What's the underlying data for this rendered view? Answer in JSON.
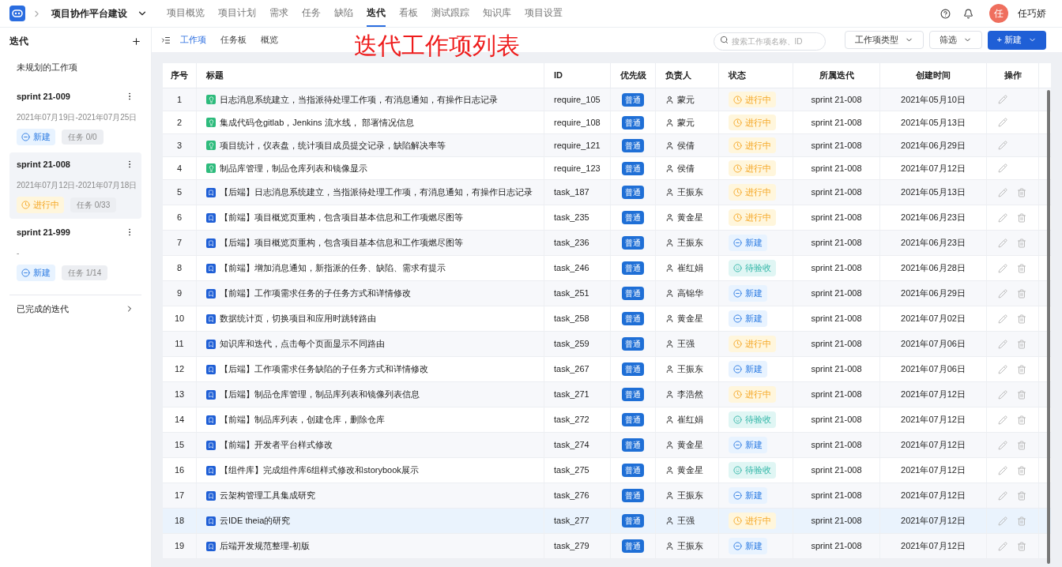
{
  "header": {
    "project": "项目协作平台建设",
    "nav": [
      {
        "label": "项目概览",
        "selected": false
      },
      {
        "label": "项目计划",
        "selected": false
      },
      {
        "label": "需求",
        "selected": false
      },
      {
        "label": "任务",
        "selected": false
      },
      {
        "label": "缺陷",
        "selected": false
      },
      {
        "label": "迭代",
        "selected": true
      },
      {
        "label": "看板",
        "selected": false
      },
      {
        "label": "测试跟踪",
        "selected": false
      },
      {
        "label": "知识库",
        "selected": false
      },
      {
        "label": "项目设置",
        "selected": false
      }
    ],
    "avatar": "任",
    "user": "任巧娇"
  },
  "sidebar": {
    "title": "迭代",
    "unplanned": "未规划的工作项",
    "sprints": [
      {
        "name": "sprint 21-009",
        "dates": "2021年07月19日-2021年07月25日",
        "status": {
          "kind": "new",
          "label": "新建"
        },
        "tasks": "任务 0/0",
        "selected": false
      },
      {
        "name": "sprint 21-008",
        "dates": "2021年07月12日-2021年07月18日",
        "status": {
          "kind": "in_progress",
          "label": "进行中"
        },
        "tasks": "任务 0/33",
        "selected": true
      },
      {
        "name": "sprint 21-999",
        "dates": "-",
        "status": {
          "kind": "new",
          "label": "新建"
        },
        "tasks": "任务 1/14",
        "selected": false
      }
    ],
    "completed": "已完成的迭代"
  },
  "subnav": {
    "tabs": [
      {
        "label": "工作项",
        "selected": true
      },
      {
        "label": "任务板",
        "selected": false
      },
      {
        "label": "概览",
        "selected": false
      }
    ],
    "search": {
      "placeholder": "搜索工作项名称、ID"
    },
    "filters": [
      "工作项类型",
      "筛选"
    ],
    "new_button": "+ 新建"
  },
  "annotation": "迭代工作项列表",
  "table": {
    "columns": [
      "序号",
      "标题",
      "ID",
      "优先级",
      "负责人",
      "状态",
      "所属迭代",
      "创建时间",
      "操作"
    ],
    "rows": [
      {
        "no": "1",
        "kind": "requirement",
        "title": "日志消息系统建立，当指派待处理工作项，有消息通知，有操作日志记录",
        "id": "require_105",
        "priority": "普通",
        "owner": "蒙元",
        "status": {
          "kind": "in_progress",
          "label": "进行中"
        },
        "sprint": "sprint 21-008",
        "created": "2021年05月10日",
        "deletable": false,
        "selected": false
      },
      {
        "no": "2",
        "kind": "requirement",
        "title": "集成代码仓gitlab，Jenkins 流水线， 部署情况信息",
        "id": "require_108",
        "priority": "普通",
        "owner": "蒙元",
        "status": {
          "kind": "in_progress",
          "label": "进行中"
        },
        "sprint": "sprint 21-008",
        "created": "2021年05月13日",
        "deletable": false,
        "selected": false
      },
      {
        "no": "3",
        "kind": "requirement",
        "title": "项目统计，仪表盘，统计项目成员提交记录，缺陷解决率等",
        "id": "require_121",
        "priority": "普通",
        "owner": "侯倩",
        "status": {
          "kind": "in_progress",
          "label": "进行中"
        },
        "sprint": "sprint 21-008",
        "created": "2021年06月29日",
        "deletable": false,
        "selected": false
      },
      {
        "no": "4",
        "kind": "requirement",
        "title": "制品库管理，制品仓库列表和镜像显示",
        "id": "require_123",
        "priority": "普通",
        "owner": "侯倩",
        "status": {
          "kind": "in_progress",
          "label": "进行中"
        },
        "sprint": "sprint 21-008",
        "created": "2021年07月12日",
        "deletable": false,
        "selected": false
      },
      {
        "no": "5",
        "kind": "task",
        "title": "【后端】日志消息系统建立，当指派待处理工作项，有消息通知，有操作日志记录",
        "id": "task_187",
        "priority": "普通",
        "owner": "王振东",
        "status": {
          "kind": "in_progress",
          "label": "进行中"
        },
        "sprint": "sprint 21-008",
        "created": "2021年05月13日",
        "deletable": true,
        "selected": false
      },
      {
        "no": "6",
        "kind": "task",
        "title": "【前端】项目概览页重构，包含项目基本信息和工作项燃尽图等",
        "id": "task_235",
        "priority": "普通",
        "owner": "黄金星",
        "status": {
          "kind": "in_progress",
          "label": "进行中"
        },
        "sprint": "sprint 21-008",
        "created": "2021年06月23日",
        "deletable": true,
        "selected": false
      },
      {
        "no": "7",
        "kind": "task",
        "title": "【后端】项目概览页重构，包含项目基本信息和工作项燃尽图等",
        "id": "task_236",
        "priority": "普通",
        "owner": "王振东",
        "status": {
          "kind": "new",
          "label": "新建"
        },
        "sprint": "sprint 21-008",
        "created": "2021年06月23日",
        "deletable": true,
        "selected": false
      },
      {
        "no": "8",
        "kind": "task",
        "title": "【前端】增加消息通知，新指派的任务、缺陷、需求有提示",
        "id": "task_246",
        "priority": "普通",
        "owner": "崔红娟",
        "status": {
          "kind": "review",
          "label": "待验收"
        },
        "sprint": "sprint 21-008",
        "created": "2021年06月28日",
        "deletable": true,
        "selected": false
      },
      {
        "no": "9",
        "kind": "task",
        "title": "【前端】工作项需求任务的子任务方式和详情修改",
        "id": "task_251",
        "priority": "普通",
        "owner": "高锦华",
        "status": {
          "kind": "new",
          "label": "新建"
        },
        "sprint": "sprint 21-008",
        "created": "2021年06月29日",
        "deletable": true,
        "selected": false
      },
      {
        "no": "10",
        "kind": "task",
        "title": "数据统计页，切换项目和应用时跳转路由",
        "id": "task_258",
        "priority": "普通",
        "owner": "黄金星",
        "status": {
          "kind": "new",
          "label": "新建"
        },
        "sprint": "sprint 21-008",
        "created": "2021年07月02日",
        "deletable": true,
        "selected": false
      },
      {
        "no": "11",
        "kind": "task",
        "title": "知识库和迭代，点击每个页面显示不同路由",
        "id": "task_259",
        "priority": "普通",
        "owner": "王强",
        "status": {
          "kind": "in_progress",
          "label": "进行中"
        },
        "sprint": "sprint 21-008",
        "created": "2021年07月06日",
        "deletable": true,
        "selected": false
      },
      {
        "no": "12",
        "kind": "task",
        "title": "【后端】工作项需求任务缺陷的子任务方式和详情修改",
        "id": "task_267",
        "priority": "普通",
        "owner": "王振东",
        "status": {
          "kind": "new",
          "label": "新建"
        },
        "sprint": "sprint 21-008",
        "created": "2021年07月06日",
        "deletable": true,
        "selected": false
      },
      {
        "no": "13",
        "kind": "task",
        "title": "【后端】制品仓库管理，制品库列表和镜像列表信息",
        "id": "task_271",
        "priority": "普通",
        "owner": "李浩然",
        "status": {
          "kind": "in_progress",
          "label": "进行中"
        },
        "sprint": "sprint 21-008",
        "created": "2021年07月12日",
        "deletable": true,
        "selected": false
      },
      {
        "no": "14",
        "kind": "task",
        "title": "【前端】制品库列表，创建仓库，删除仓库",
        "id": "task_272",
        "priority": "普通",
        "owner": "崔红娟",
        "status": {
          "kind": "review",
          "label": "待验收"
        },
        "sprint": "sprint 21-008",
        "created": "2021年07月12日",
        "deletable": true,
        "selected": false
      },
      {
        "no": "15",
        "kind": "task",
        "title": "【前端】开发者平台样式修改",
        "id": "task_274",
        "priority": "普通",
        "owner": "黄金星",
        "status": {
          "kind": "new",
          "label": "新建"
        },
        "sprint": "sprint 21-008",
        "created": "2021年07月12日",
        "deletable": true,
        "selected": false
      },
      {
        "no": "16",
        "kind": "task",
        "title": "【组件库】完成组件库6组样式修改和storybook展示",
        "id": "task_275",
        "priority": "普通",
        "owner": "黄金星",
        "status": {
          "kind": "review",
          "label": "待验收"
        },
        "sprint": "sprint 21-008",
        "created": "2021年07月12日",
        "deletable": true,
        "selected": false
      },
      {
        "no": "17",
        "kind": "task",
        "title": "云架构管理工具集成研究",
        "id": "task_276",
        "priority": "普通",
        "owner": "王振东",
        "status": {
          "kind": "new",
          "label": "新建"
        },
        "sprint": "sprint 21-008",
        "created": "2021年07月12日",
        "deletable": true,
        "selected": false
      },
      {
        "no": "18",
        "kind": "task",
        "title": "云IDE theia的研究",
        "id": "task_277",
        "priority": "普通",
        "owner": "王强",
        "status": {
          "kind": "in_progress",
          "label": "进行中"
        },
        "sprint": "sprint 21-008",
        "created": "2021年07月12日",
        "deletable": true,
        "selected": true
      },
      {
        "no": "19",
        "kind": "task",
        "title": "后端开发规范整理-初版",
        "id": "task_279",
        "priority": "普通",
        "owner": "王振东",
        "status": {
          "kind": "new",
          "label": "新建"
        },
        "sprint": "sprint 21-008",
        "created": "2021年07月12日",
        "deletable": true,
        "selected": false
      }
    ]
  }
}
